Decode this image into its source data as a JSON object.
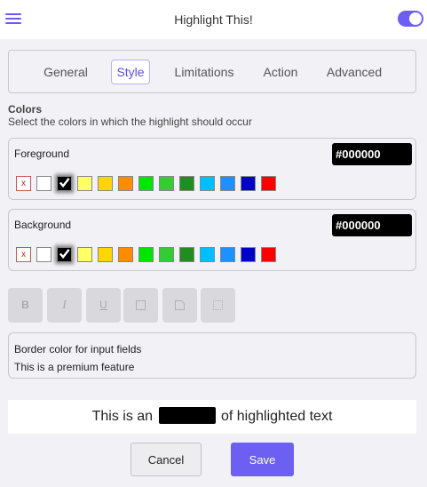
{
  "header": {
    "title": "Highlight This!",
    "menu_icon": "hamburger-menu-icon",
    "toggle_on": true,
    "accent": "#6c5ff2"
  },
  "tabs": [
    {
      "label": "General",
      "active": false
    },
    {
      "label": "Style",
      "active": true
    },
    {
      "label": "Limitations",
      "active": false
    },
    {
      "label": "Action",
      "active": false
    },
    {
      "label": "Advanced",
      "active": false
    }
  ],
  "colors_section": {
    "title": "Colors",
    "description": "Select the colors in which the highlight should occur"
  },
  "palette": [
    "none",
    "#ffffff",
    "#000000",
    "#ffff66",
    "#ffd700",
    "#ff8c00",
    "#00e600",
    "#33cc33",
    "#228b22",
    "#00bfff",
    "#1e90ff",
    "#0000cd",
    "#ff0000"
  ],
  "clear_symbol": "x",
  "foreground": {
    "label": "Foreground",
    "value": "#000000",
    "selected": "#000000"
  },
  "background": {
    "label": "Background",
    "value": "#000000",
    "selected": "#000000"
  },
  "format_buttons": [
    {
      "name": "bold-button",
      "glyph": "B",
      "icon": "bold-icon"
    },
    {
      "name": "italic-button",
      "glyph": "I",
      "icon": "italic-icon"
    },
    {
      "name": "underline-button",
      "glyph": "U",
      "icon": "underline-icon"
    },
    {
      "name": "border-button",
      "glyph": "",
      "icon": "border-icon"
    },
    {
      "name": "rounded-corner-button",
      "glyph": "",
      "icon": "rounded-corner-icon"
    },
    {
      "name": "padding-button",
      "glyph": "",
      "icon": "padding-icon"
    }
  ],
  "premium": {
    "title": "Border color for input fields",
    "note": "This is a premium feature"
  },
  "preview": {
    "before": "This is an",
    "after": "of highlighted text"
  },
  "actions": {
    "cancel_label": "Cancel",
    "save_label": "Save"
  }
}
